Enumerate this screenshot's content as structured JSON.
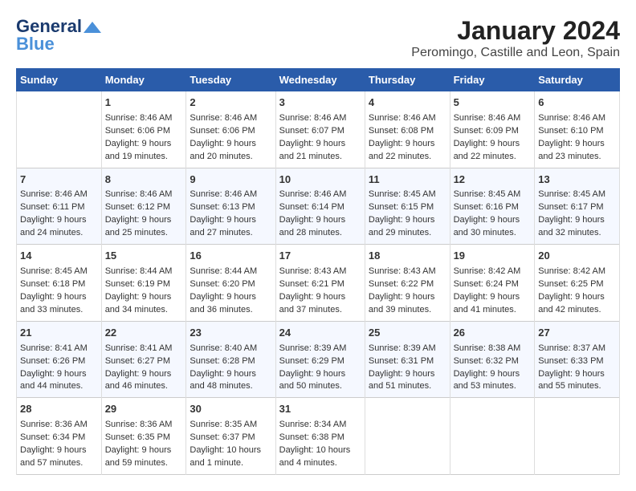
{
  "header": {
    "logo_general": "General",
    "logo_blue": "Blue",
    "month": "January 2024",
    "location": "Peromingo, Castille and Leon, Spain"
  },
  "days_of_week": [
    "Sunday",
    "Monday",
    "Tuesday",
    "Wednesday",
    "Thursday",
    "Friday",
    "Saturday"
  ],
  "weeks": [
    [
      {
        "day": "",
        "content": ""
      },
      {
        "day": "1",
        "content": "Sunrise: 8:46 AM\nSunset: 6:06 PM\nDaylight: 9 hours\nand 19 minutes."
      },
      {
        "day": "2",
        "content": "Sunrise: 8:46 AM\nSunset: 6:06 PM\nDaylight: 9 hours\nand 20 minutes."
      },
      {
        "day": "3",
        "content": "Sunrise: 8:46 AM\nSunset: 6:07 PM\nDaylight: 9 hours\nand 21 minutes."
      },
      {
        "day": "4",
        "content": "Sunrise: 8:46 AM\nSunset: 6:08 PM\nDaylight: 9 hours\nand 22 minutes."
      },
      {
        "day": "5",
        "content": "Sunrise: 8:46 AM\nSunset: 6:09 PM\nDaylight: 9 hours\nand 22 minutes."
      },
      {
        "day": "6",
        "content": "Sunrise: 8:46 AM\nSunset: 6:10 PM\nDaylight: 9 hours\nand 23 minutes."
      }
    ],
    [
      {
        "day": "7",
        "content": "Sunrise: 8:46 AM\nSunset: 6:11 PM\nDaylight: 9 hours\nand 24 minutes."
      },
      {
        "day": "8",
        "content": "Sunrise: 8:46 AM\nSunset: 6:12 PM\nDaylight: 9 hours\nand 25 minutes."
      },
      {
        "day": "9",
        "content": "Sunrise: 8:46 AM\nSunset: 6:13 PM\nDaylight: 9 hours\nand 27 minutes."
      },
      {
        "day": "10",
        "content": "Sunrise: 8:46 AM\nSunset: 6:14 PM\nDaylight: 9 hours\nand 28 minutes."
      },
      {
        "day": "11",
        "content": "Sunrise: 8:45 AM\nSunset: 6:15 PM\nDaylight: 9 hours\nand 29 minutes."
      },
      {
        "day": "12",
        "content": "Sunrise: 8:45 AM\nSunset: 6:16 PM\nDaylight: 9 hours\nand 30 minutes."
      },
      {
        "day": "13",
        "content": "Sunrise: 8:45 AM\nSunset: 6:17 PM\nDaylight: 9 hours\nand 32 minutes."
      }
    ],
    [
      {
        "day": "14",
        "content": "Sunrise: 8:45 AM\nSunset: 6:18 PM\nDaylight: 9 hours\nand 33 minutes."
      },
      {
        "day": "15",
        "content": "Sunrise: 8:44 AM\nSunset: 6:19 PM\nDaylight: 9 hours\nand 34 minutes."
      },
      {
        "day": "16",
        "content": "Sunrise: 8:44 AM\nSunset: 6:20 PM\nDaylight: 9 hours\nand 36 minutes."
      },
      {
        "day": "17",
        "content": "Sunrise: 8:43 AM\nSunset: 6:21 PM\nDaylight: 9 hours\nand 37 minutes."
      },
      {
        "day": "18",
        "content": "Sunrise: 8:43 AM\nSunset: 6:22 PM\nDaylight: 9 hours\nand 39 minutes."
      },
      {
        "day": "19",
        "content": "Sunrise: 8:42 AM\nSunset: 6:24 PM\nDaylight: 9 hours\nand 41 minutes."
      },
      {
        "day": "20",
        "content": "Sunrise: 8:42 AM\nSunset: 6:25 PM\nDaylight: 9 hours\nand 42 minutes."
      }
    ],
    [
      {
        "day": "21",
        "content": "Sunrise: 8:41 AM\nSunset: 6:26 PM\nDaylight: 9 hours\nand 44 minutes."
      },
      {
        "day": "22",
        "content": "Sunrise: 8:41 AM\nSunset: 6:27 PM\nDaylight: 9 hours\nand 46 minutes."
      },
      {
        "day": "23",
        "content": "Sunrise: 8:40 AM\nSunset: 6:28 PM\nDaylight: 9 hours\nand 48 minutes."
      },
      {
        "day": "24",
        "content": "Sunrise: 8:39 AM\nSunset: 6:29 PM\nDaylight: 9 hours\nand 50 minutes."
      },
      {
        "day": "25",
        "content": "Sunrise: 8:39 AM\nSunset: 6:31 PM\nDaylight: 9 hours\nand 51 minutes."
      },
      {
        "day": "26",
        "content": "Sunrise: 8:38 AM\nSunset: 6:32 PM\nDaylight: 9 hours\nand 53 minutes."
      },
      {
        "day": "27",
        "content": "Sunrise: 8:37 AM\nSunset: 6:33 PM\nDaylight: 9 hours\nand 55 minutes."
      }
    ],
    [
      {
        "day": "28",
        "content": "Sunrise: 8:36 AM\nSunset: 6:34 PM\nDaylight: 9 hours\nand 57 minutes."
      },
      {
        "day": "29",
        "content": "Sunrise: 8:36 AM\nSunset: 6:35 PM\nDaylight: 9 hours\nand 59 minutes."
      },
      {
        "day": "30",
        "content": "Sunrise: 8:35 AM\nSunset: 6:37 PM\nDaylight: 10 hours\nand 1 minute."
      },
      {
        "day": "31",
        "content": "Sunrise: 8:34 AM\nSunset: 6:38 PM\nDaylight: 10 hours\nand 4 minutes."
      },
      {
        "day": "",
        "content": ""
      },
      {
        "day": "",
        "content": ""
      },
      {
        "day": "",
        "content": ""
      }
    ]
  ]
}
